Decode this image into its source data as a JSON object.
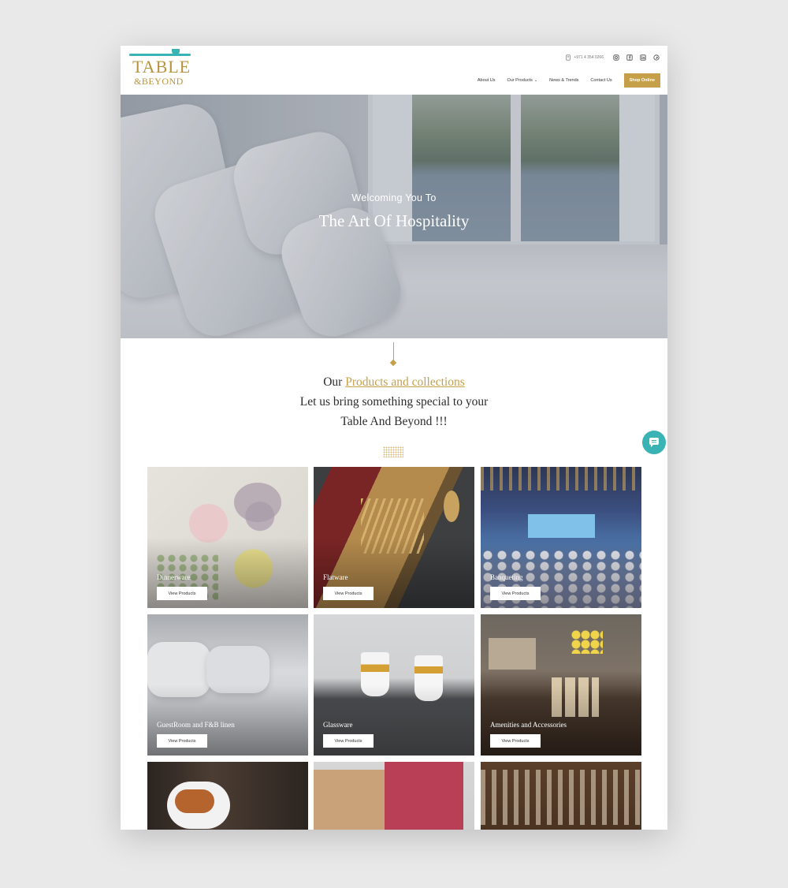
{
  "header": {
    "logo_main": "TABLE",
    "logo_sub": "&BEYOND",
    "phone": "+971 4 354 0266",
    "social_icons": [
      "instagram-icon",
      "facebook-icon",
      "linkedin-icon",
      "pinterest-icon"
    ],
    "nav": {
      "about": "About Us",
      "products": "Our Products",
      "news": "News & Trends",
      "contact": "Contact Us",
      "shop": "Shop Online"
    }
  },
  "hero": {
    "subtitle": "Welcoming You To",
    "title": "The Art Of Hospitality"
  },
  "intro": {
    "prefix": "Our ",
    "highlight": "Products and collections",
    "line2": "Let us bring something special to your",
    "line3": "Table And Beyond !!!"
  },
  "cards": [
    {
      "name": "Dinnerware",
      "button": "View Products"
    },
    {
      "name": "Flatware",
      "button": "View Products"
    },
    {
      "name": "Banqueting",
      "button": "View Products"
    },
    {
      "name": "GuestRoom and F&B linen",
      "button": "View Products"
    },
    {
      "name": "Glassware",
      "button": "View Products"
    },
    {
      "name": "Amenities and Accessories",
      "button": "View Products"
    }
  ],
  "colors": {
    "accent_gold": "#c5a049",
    "accent_teal": "#3ab3b5"
  }
}
